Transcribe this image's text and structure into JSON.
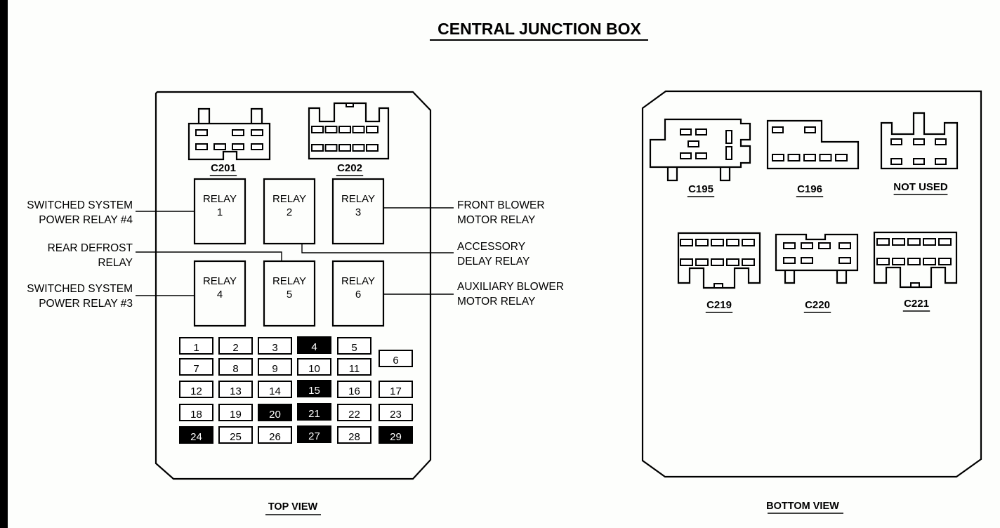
{
  "title": "CENTRAL JUNCTION BOX",
  "top_view": {
    "label": "TOP VIEW",
    "connectors": [
      {
        "id": "C201",
        "label": "C201"
      },
      {
        "id": "C202",
        "label": "C202"
      }
    ],
    "relays": [
      {
        "label": "RELAY",
        "number": "1",
        "description": [
          "SWITCHED SYSTEM",
          "POWER RELAY #4"
        ],
        "side": "left"
      },
      {
        "label": "RELAY",
        "number": "2",
        "description": [
          "ACCESSORY",
          "DELAY RELAY"
        ],
        "side": "right"
      },
      {
        "label": "RELAY",
        "number": "3",
        "description": [
          "FRONT BLOWER",
          "MOTOR RELAY"
        ],
        "side": "right"
      },
      {
        "label": "RELAY",
        "number": "4",
        "description": [
          "SWITCHED SYSTEM",
          "POWER RELAY #3"
        ],
        "side": "left"
      },
      {
        "label": "RELAY",
        "number": "5",
        "description": [
          "REAR DEFROST",
          "RELAY"
        ],
        "side": "left"
      },
      {
        "label": "RELAY",
        "number": "6",
        "description": [
          "AUXILIARY BLOWER",
          "MOTOR RELAY"
        ],
        "side": "right"
      }
    ],
    "fuses": [
      {
        "n": "1",
        "filled": false
      },
      {
        "n": "2",
        "filled": false
      },
      {
        "n": "3",
        "filled": false
      },
      {
        "n": "4",
        "filled": true
      },
      {
        "n": "5",
        "filled": false
      },
      {
        "n": "6",
        "filled": false
      },
      {
        "n": "7",
        "filled": false
      },
      {
        "n": "8",
        "filled": false
      },
      {
        "n": "9",
        "filled": false
      },
      {
        "n": "10",
        "filled": false
      },
      {
        "n": "11",
        "filled": false
      },
      {
        "n": "12",
        "filled": false
      },
      {
        "n": "13",
        "filled": false
      },
      {
        "n": "14",
        "filled": false
      },
      {
        "n": "15",
        "filled": true
      },
      {
        "n": "16",
        "filled": false
      },
      {
        "n": "17",
        "filled": false
      },
      {
        "n": "18",
        "filled": false
      },
      {
        "n": "19",
        "filled": false
      },
      {
        "n": "20",
        "filled": true
      },
      {
        "n": "21",
        "filled": true
      },
      {
        "n": "22",
        "filled": false
      },
      {
        "n": "23",
        "filled": false
      },
      {
        "n": "24",
        "filled": true
      },
      {
        "n": "25",
        "filled": false
      },
      {
        "n": "26",
        "filled": false
      },
      {
        "n": "27",
        "filled": true
      },
      {
        "n": "28",
        "filled": false
      },
      {
        "n": "29",
        "filled": true
      }
    ]
  },
  "bottom_view": {
    "label": "BOTTOM VIEW",
    "connectors": [
      {
        "id": "C195",
        "label": "C195"
      },
      {
        "id": "C196",
        "label": "C196"
      },
      {
        "id": "NOT_USED",
        "label": "NOT USED"
      },
      {
        "id": "C219",
        "label": "C219"
      },
      {
        "id": "C220",
        "label": "C220"
      },
      {
        "id": "C221",
        "label": "C221"
      }
    ]
  },
  "colors": {
    "ink": "#000000",
    "paper": "#fdfefc"
  }
}
